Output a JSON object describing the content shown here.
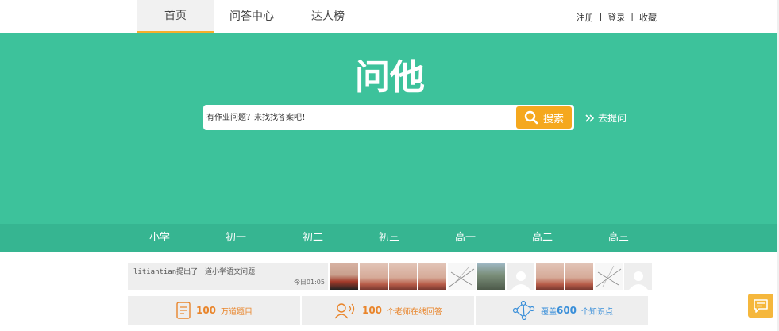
{
  "nav": {
    "tabs": [
      {
        "label": "首页",
        "active": true
      },
      {
        "label": "问答中心",
        "active": false
      },
      {
        "label": "达人榜",
        "active": false
      }
    ],
    "links": {
      "register": "注册",
      "sep1": "|",
      "login": "登录",
      "sep2": "|",
      "favorite": "收藏"
    }
  },
  "hero": {
    "logo_text": "问他",
    "search": {
      "placeholder": "有作业问题？来找找答案吧！",
      "value": "",
      "button_label": "搜索",
      "button_icon": "search-icon"
    },
    "ask_label": "去提问",
    "ask_icon": "double-chevron-right-icon"
  },
  "grades": [
    "小学",
    "初一",
    "初二",
    "初三",
    "高一",
    "高二",
    "高三"
  ],
  "activity": {
    "text": "litiantian提出了一道小学语文问题",
    "time": "今日01:05"
  },
  "stats": [
    {
      "num": "100",
      "label": "万道题目",
      "icon": "document-icon"
    },
    {
      "num": "100",
      "label": "个老师在线回答",
      "icon": "person-speaking-icon"
    },
    {
      "prefix": "覆盖",
      "num": "600",
      "label": "个知识点",
      "icon": "network-icon"
    }
  ],
  "colors": {
    "hero": "#3dc29b",
    "grade_bar": "#36b591",
    "accent": "#f5a81e",
    "stat_orange": "#e9852b",
    "stat_blue": "#3a8fd9"
  },
  "chat_icon": "chat-bubble-icon"
}
